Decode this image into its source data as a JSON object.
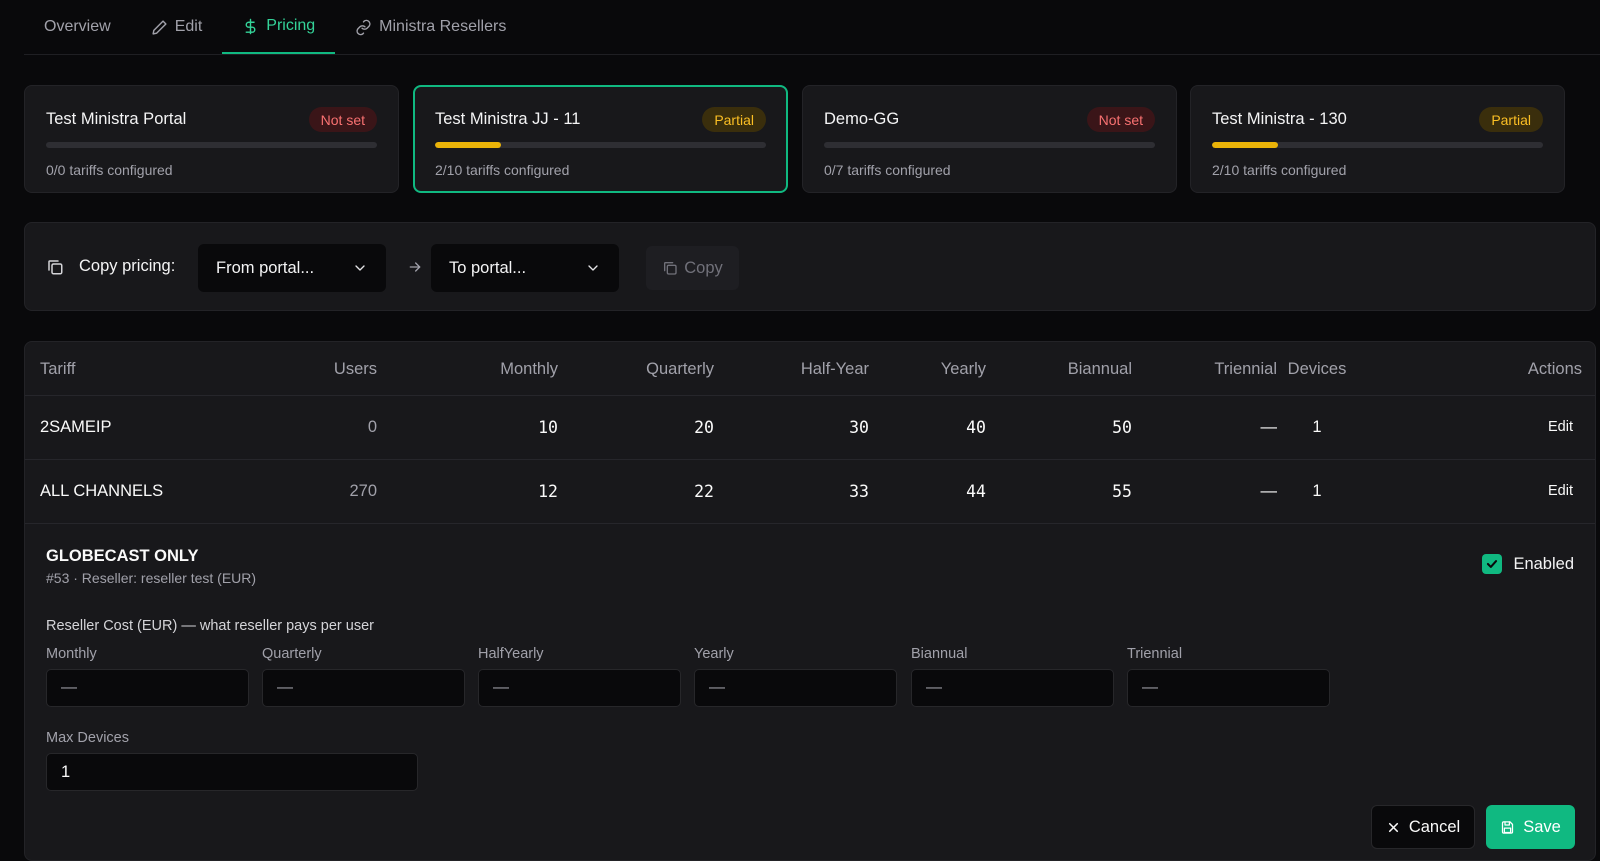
{
  "tabs": [
    {
      "label": "Overview",
      "icon": ""
    },
    {
      "label": "Edit",
      "icon": "pencil-icon"
    },
    {
      "label": "Pricing",
      "icon": "dollar-icon",
      "active": true
    },
    {
      "label": "Ministra Resellers",
      "icon": "link-icon"
    }
  ],
  "portals": [
    {
      "name": "Test Ministra Portal",
      "status": "Not set",
      "configured": 0,
      "total": 0,
      "summary": "0/0 tariffs configured"
    },
    {
      "name": "Test Ministra JJ - 11",
      "status": "Partial",
      "configured": 2,
      "total": 10,
      "summary": "2/10 tariffs configured",
      "selected": true
    },
    {
      "name": "Demo-GG",
      "status": "Not set",
      "configured": 0,
      "total": 7,
      "summary": "0/7 tariffs configured"
    },
    {
      "name": "Test Ministra - 130",
      "status": "Partial",
      "configured": 2,
      "total": 10,
      "summary": "2/10 tariffs configured"
    }
  ],
  "copy": {
    "label": "Copy pricing:",
    "from_placeholder": "From portal...",
    "to_placeholder": "To portal...",
    "button": "Copy"
  },
  "table": {
    "headers": {
      "tariff": "Tariff",
      "users": "Users",
      "monthly": "Monthly",
      "quarterly": "Quarterly",
      "halfyear": "Half-Year",
      "yearly": "Yearly",
      "biannual": "Biannual",
      "triennial": "Triennial",
      "devices": "Devices",
      "actions": "Actions"
    },
    "rows": [
      {
        "tariff": "2SAMEIP",
        "users": "0",
        "monthly": "10",
        "quarterly": "20",
        "halfyear": "30",
        "yearly": "40",
        "biannual": "50",
        "triennial": "—",
        "devices": "1",
        "action": "Edit"
      },
      {
        "tariff": "ALL CHANNELS",
        "users": "270",
        "monthly": "12",
        "quarterly": "22",
        "halfyear": "33",
        "yearly": "44",
        "biannual": "55",
        "triennial": "—",
        "devices": "1",
        "action": "Edit"
      }
    ]
  },
  "editor": {
    "title": "GLOBECAST ONLY",
    "subtitle": "#53 · Reseller: reseller test (EUR)",
    "enabled_label": "Enabled",
    "enabled": true,
    "section_label": "Reseller Cost (EUR) — what reseller pays per user",
    "fields": [
      {
        "label": "Monthly",
        "placeholder": "—"
      },
      {
        "label": "Quarterly",
        "placeholder": "—"
      },
      {
        "label": "HalfYearly",
        "placeholder": "—"
      },
      {
        "label": "Yearly",
        "placeholder": "—"
      },
      {
        "label": "Biannual",
        "placeholder": "—"
      },
      {
        "label": "Triennial",
        "placeholder": "—"
      }
    ],
    "max_devices_label": "Max Devices",
    "max_devices_value": "1",
    "cancel_label": "Cancel",
    "save_label": "Save"
  },
  "colors": {
    "accent": "#10b981",
    "partial": "#eab308",
    "not_set": "#f87171",
    "background": "#09090b",
    "panel": "#18181b"
  }
}
